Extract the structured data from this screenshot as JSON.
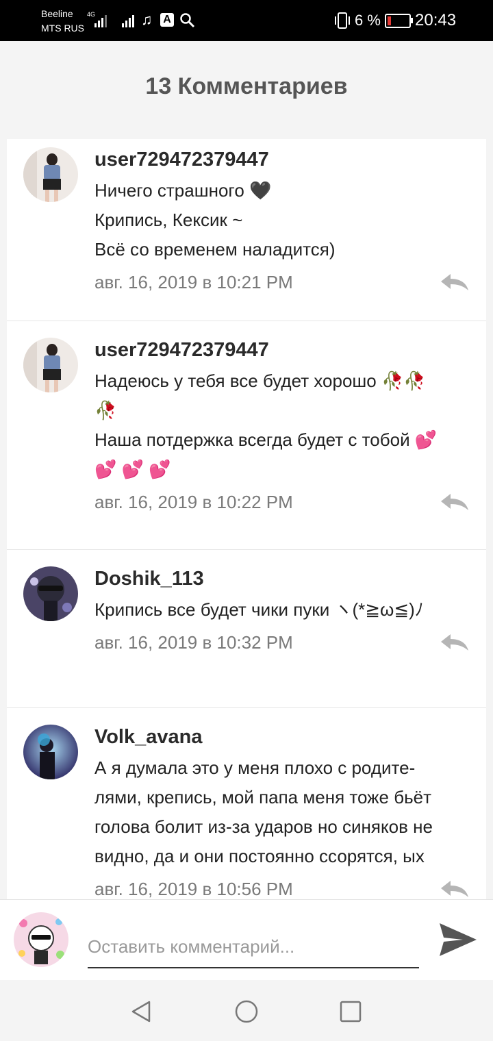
{
  "status_bar": {
    "carrier_1": "Beeline",
    "carrier_2": "MTS RUS",
    "network": "4G",
    "battery_percent": "6 %",
    "time": "20:43"
  },
  "header": {
    "title": "13 Комментариев"
  },
  "comments": [
    {
      "author": "user729472379447",
      "lines": [
        "Ничего страшного 🖤",
        "Крипись, Кексик ~",
        "Всё  со временем наладится)"
      ],
      "date": "авг. 16, 2019 в 10:21 PM"
    },
    {
      "author": "user729472379447",
      "lines": [
        "Надеюсь у тебя все будет хорошо 🥀🥀",
        "🥀",
        "Наша потдержка всегда будет с тобой 💕",
        "💕 💕 💕"
      ],
      "date": "авг. 16, 2019 в 10:22 PM"
    },
    {
      "author": "Doshik_113",
      "lines": [
        "Крипись все будет чики пуки ヽ(*≧ω≦)ﾉ"
      ],
      "date": "авг. 16, 2019 в 10:32 PM"
    },
    {
      "author": "Volk_avana",
      "lines": [
        "А я думала это у меня плохо с родите-",
        "лями, крепись, мой папа меня тоже бьёт",
        "голова болит из-за ударов но синяков не",
        "видно, да и они постоянно ссорятся, ых"
      ],
      "date": "авг. 16, 2019 в 10:56 PM"
    }
  ],
  "input_bar": {
    "placeholder": "Оставить комментарий..."
  },
  "icons": {
    "reply": "reply-arrow-icon",
    "send": "send-icon",
    "nav_back": "triangle-back-icon",
    "nav_home": "circle-home-icon",
    "nav_recent": "square-recent-icon"
  }
}
